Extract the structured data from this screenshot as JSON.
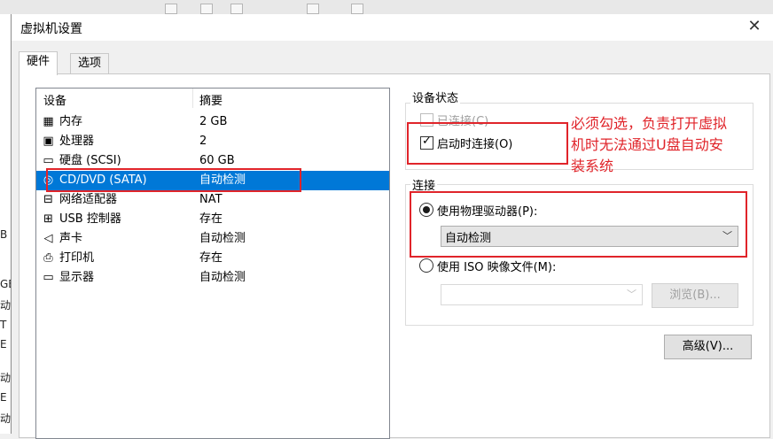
{
  "background": {
    "left_edge_fragments": [
      "B",
      "GE",
      "动栏",
      "T",
      "E",
      "动栏",
      "E",
      "动栏"
    ]
  },
  "dialog": {
    "title": "虚拟机设置",
    "close_glyph": "✕",
    "tabs": [
      {
        "label": "硬件",
        "active": true
      },
      {
        "label": "选项",
        "active": false
      }
    ]
  },
  "device_list": {
    "headers": {
      "device": "设备",
      "summary": "摘要"
    },
    "rows": [
      {
        "icon": "memory-icon",
        "name": "内存",
        "summary": "2 GB",
        "selected": false
      },
      {
        "icon": "processor-icon",
        "name": "处理器",
        "summary": "2",
        "selected": false
      },
      {
        "icon": "hard-disk-icon",
        "name": "硬盘 (SCSI)",
        "summary": "60 GB",
        "selected": false
      },
      {
        "icon": "cd-dvd-icon",
        "name": "CD/DVD (SATA)",
        "summary": "自动检测",
        "selected": true
      },
      {
        "icon": "network-adapter-icon",
        "name": "网络适配器",
        "summary": "NAT",
        "selected": false
      },
      {
        "icon": "usb-icon",
        "name": "USB 控制器",
        "summary": "存在",
        "selected": false
      },
      {
        "icon": "sound-card-icon",
        "name": "声卡",
        "summary": "自动检测",
        "selected": false
      },
      {
        "icon": "printer-icon",
        "name": "打印机",
        "summary": "存在",
        "selected": false
      },
      {
        "icon": "display-icon",
        "name": "显示器",
        "summary": "自动检测",
        "selected": false
      }
    ]
  },
  "device_status": {
    "label": "设备状态",
    "connected": {
      "label": "已连接(C)",
      "checked": false,
      "enabled": false
    },
    "connect_at_power_on": {
      "label": "启动时连接(O)",
      "checked": true,
      "enabled": true
    }
  },
  "connection": {
    "label": "连接",
    "use_physical": {
      "label": "使用物理驱动器(P):",
      "selected": true
    },
    "physical_drive_value": "自动检测",
    "use_iso": {
      "label": "使用 ISO 映像文件(M):",
      "selected": false
    },
    "iso_value": "",
    "browse_label": "浏览(B)...",
    "advanced_label": "高级(V)..."
  },
  "annotation": {
    "lines": [
      "必须勾选，负责打开虚拟",
      "机时无法通过U盘自动安",
      "装系统"
    ],
    "color": "#e0242a"
  },
  "colors": {
    "selection": "#0078d7",
    "annotation_red": "#e0242a"
  }
}
